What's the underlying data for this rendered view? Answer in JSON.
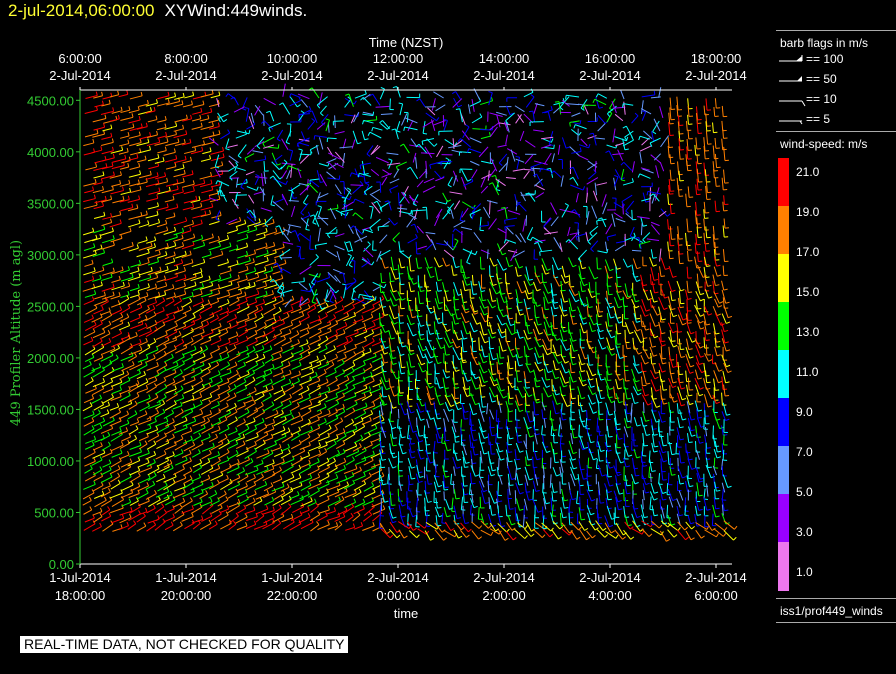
{
  "header": {
    "date": "2-jul-2014,06:00:00",
    "title": "XYWind:449winds."
  },
  "chart_data": {
    "type": "wind-barb",
    "top_axis_title": "Time (NZST)",
    "top_ticks": [
      {
        "time": "6:00:00",
        "date": "2-Jul-2014"
      },
      {
        "time": "8:00:00",
        "date": "2-Jul-2014"
      },
      {
        "time": "10:00:00",
        "date": "2-Jul-2014"
      },
      {
        "time": "12:00:00",
        "date": "2-Jul-2014"
      },
      {
        "time": "14:00:00",
        "date": "2-Jul-2014"
      },
      {
        "time": "16:00:00",
        "date": "2-Jul-2014"
      },
      {
        "time": "18:00:00",
        "date": "2-Jul-2014"
      }
    ],
    "xlabel": "time",
    "bottom_ticks": [
      {
        "date": "1-Jul-2014",
        "time": "18:00:00"
      },
      {
        "date": "1-Jul-2014",
        "time": "20:00:00"
      },
      {
        "date": "1-Jul-2014",
        "time": "22:00:00"
      },
      {
        "date": "2-Jul-2014",
        "time": "0:00:00"
      },
      {
        "date": "2-Jul-2014",
        "time": "2:00:00"
      },
      {
        "date": "2-Jul-2014",
        "time": "4:00:00"
      },
      {
        "date": "2-Jul-2014",
        "time": "6:00:00"
      }
    ],
    "xlim": [
      "1-Jul-2014 18:00:00",
      "2-Jul-2014 06:18:00"
    ],
    "ylabel": "449 Profiler Altitude (m agl)",
    "ylim": [
      0,
      4600
    ],
    "y_ticks": [
      "0.00",
      "500.00",
      "1000.00",
      "1500.00",
      "2000.00",
      "2500.00",
      "3000.00",
      "3500.00",
      "4000.00",
      "4500.00"
    ],
    "y_tick_values": [
      0,
      500,
      1000,
      1500,
      2000,
      2500,
      3000,
      3500,
      4000,
      4500
    ],
    "axis_color": "#33cc33",
    "legend": {
      "barb_title": "barb flags in m/s",
      "barb_entries": [
        "== 100",
        "== 50",
        "== 10",
        "== 5"
      ],
      "speed_title": "wind-speed: m/s",
      "speed_labels": [
        "21.0",
        "19.0",
        "17.0",
        "15.0",
        "13.0",
        "11.0",
        "9.0",
        "7.0",
        "5.0",
        "3.0",
        "1.0"
      ],
      "speed_colors": [
        "#ff0000",
        "#ff8000",
        "#ffff00",
        "#00ff00",
        "#00ffff",
        "#0000ff",
        "#6699ff",
        "#9900ff",
        "#ee77ee"
      ],
      "source": "iss1/prof449_winds"
    },
    "note": "REAL-TIME DATA, NOT CHECKED FOR QUALITY"
  }
}
